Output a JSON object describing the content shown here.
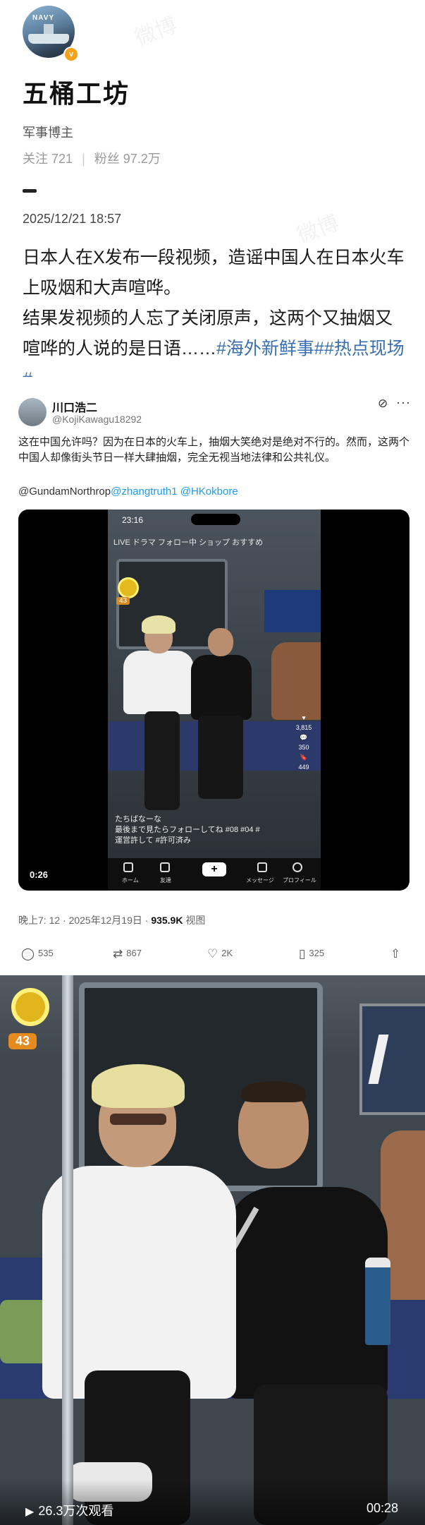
{
  "profile": {
    "avatar_text": "NAVY",
    "verified_badge": "v",
    "name": "五桶工坊",
    "role": "军事博主",
    "following_label": "关注",
    "following_count": "721",
    "followers_label": "粉丝",
    "followers_count": "97.2万"
  },
  "post": {
    "time": "2025/12/21 18:57",
    "text": "日本人在X发布一段视频，造谣中国人在日本火车上吸烟和大声喧哗。",
    "text2": "结果发视频的人忘了关闭原声，这两个又抽烟又喧哗的人说的是日语……",
    "tags": "#海外新鲜事##热点现场#"
  },
  "tweet": {
    "name": "川口浩二",
    "handle": "@KojiKawagu18292",
    "text": "这在中国允许吗？因为在日本的火车上，抽烟大笑绝对是绝对不行的。然而，这两个中国人却像街头节日一样大肆抽烟，完全无视当地法律和公共礼仪。",
    "mention_prefix": "@GundamNorthrop",
    "mention_links": "@zhangtruth1 @HKokbore",
    "video_duration": "0:26",
    "meta_time": "晚上7: 12 · 2025年12月19日 · ",
    "meta_views": "935.9K",
    "meta_views_label": " 视图",
    "actions": {
      "replies": "535",
      "reposts": "867",
      "likes": "2K",
      "bookmarks": "325"
    }
  },
  "phone": {
    "time": "23:16",
    "nav": "LIVE  ドラマ  フォロー中  ショップ  おすすめ",
    "level": "43",
    "likes": "3,815",
    "comments": "350",
    "saves": "449",
    "caption_user": "たちばなーな",
    "caption_text": "最後まで見たらフォローしてね #08 #04 #運営許して #許可済み",
    "tabs": [
      "ホーム",
      "友達",
      "+",
      "メッセージ",
      "プロフィール"
    ]
  },
  "bigvideo": {
    "level": "43",
    "views": "26.3万次观看",
    "duration": "00:28"
  }
}
